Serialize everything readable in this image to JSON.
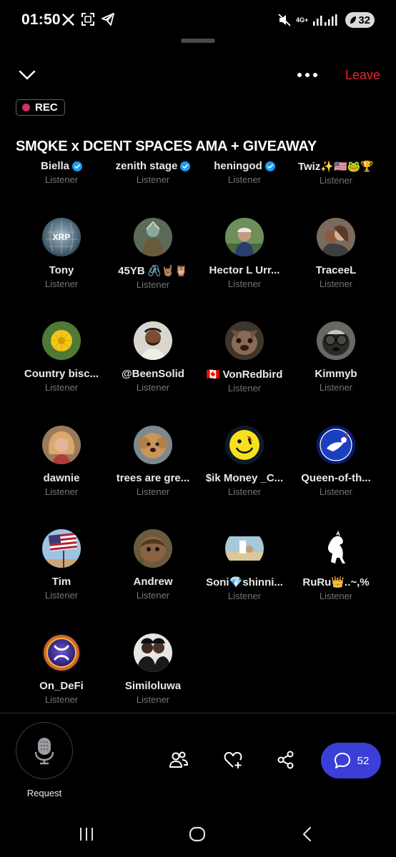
{
  "status_bar": {
    "time": "01:50",
    "network_type": "4G+",
    "battery": "32",
    "icons": [
      "x-logo-icon",
      "screenshot-icon",
      "telegram-icon",
      "mute-icon",
      "signal-icon",
      "battery-icon"
    ]
  },
  "header": {
    "leave_label": "Leave",
    "rec_label": "REC",
    "title": "SMQKE x DCENT SPACES AMA + GIVEAWAY"
  },
  "listeners": [
    {
      "name": "Biella",
      "role": "Listener",
      "verified": true,
      "avatar": "dark"
    },
    {
      "name": "zenith stage",
      "role": "Listener",
      "verified": true,
      "avatar": "dark"
    },
    {
      "name": "heningod",
      "role": "Listener",
      "verified": true,
      "avatar": "dark"
    },
    {
      "name": "Twiz✨🇺🇸🐸🏆",
      "role": "Listener",
      "verified": false,
      "avatar": "dark"
    },
    {
      "name": "Tony",
      "role": "Listener",
      "verified": false,
      "avatar": "xrp-globe"
    },
    {
      "name": "45YB 🖇️🤘🏽🦉",
      "role": "Listener",
      "verified": false,
      "avatar": "warrior"
    },
    {
      "name": "Hector L Urr...",
      "role": "Listener",
      "verified": false,
      "avatar": "cyclist"
    },
    {
      "name": "TraceeL",
      "role": "Listener",
      "verified": false,
      "avatar": "couple"
    },
    {
      "name": "Country bisc...",
      "role": "Listener",
      "verified": false,
      "avatar": "dandelion"
    },
    {
      "name": "@BeenSolid",
      "role": "Listener",
      "verified": false,
      "avatar": "bearded-man"
    },
    {
      "name": "🇨🇦 VonRedbird",
      "role": "Listener",
      "verified": false,
      "avatar": "bulldog"
    },
    {
      "name": "Kimmyb",
      "role": "Listener",
      "verified": false,
      "avatar": "dog-glasses"
    },
    {
      "name": "dawnie",
      "role": "Listener",
      "verified": false,
      "avatar": "woman-blonde"
    },
    {
      "name": "trees are gre...",
      "role": "Listener",
      "verified": false,
      "avatar": "doodle-dog"
    },
    {
      "name": "$ik Money _C...",
      "role": "Listener",
      "verified": false,
      "avatar": "smiley"
    },
    {
      "name": "Queen-of-th...",
      "role": "Listener",
      "verified": false,
      "avatar": "bird-circle"
    },
    {
      "name": "Tim",
      "role": "Listener",
      "verified": false,
      "avatar": "flag"
    },
    {
      "name": "Andrew",
      "role": "Listener",
      "verified": false,
      "avatar": "ewok"
    },
    {
      "name": "Soni💎shinni...",
      "role": "Listener",
      "verified": false,
      "avatar": "beach-photo"
    },
    {
      "name": "RuRu👑..~,%",
      "role": "Listener",
      "verified": false,
      "avatar": "horse"
    },
    {
      "name": "On_DeFi",
      "role": "Listener",
      "verified": false,
      "avatar": "xrp-coin"
    },
    {
      "name": "Similoluwa",
      "role": "Listener",
      "verified": false,
      "avatar": "two-women"
    }
  ],
  "controls": {
    "request_label": "Request",
    "chat_count": "52",
    "icons": [
      "microphone-icon",
      "people-icon",
      "heart-plus-icon",
      "share-icon",
      "chat-bubble-icon"
    ]
  },
  "nav_bar": {
    "icons": [
      "recent-apps-icon",
      "home-icon",
      "back-icon"
    ]
  },
  "colors": {
    "background": "#000000",
    "leave": "#f4212e",
    "rec_dot": "#d0315d",
    "chat_button": "#3a3fd8",
    "verified": "#1d9bf0",
    "secondary_text": "#71767b"
  }
}
